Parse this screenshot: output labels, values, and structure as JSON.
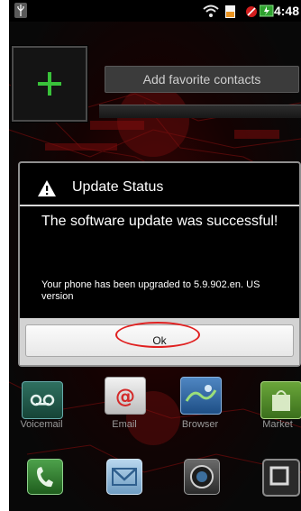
{
  "status_bar": {
    "time": "4:48"
  },
  "home_widget": {
    "favorites_label": "Add favorite contacts"
  },
  "dialog": {
    "title": "Update Status",
    "message": "The software update was successful!",
    "detail": "Your phone has been upgraded to 5.9.902.en. US version",
    "button_label": "Ok"
  },
  "dock": {
    "apps": [
      {
        "label": "Voicemail"
      },
      {
        "label": "Email"
      },
      {
        "label": "Browser"
      },
      {
        "label": "Market"
      }
    ]
  },
  "colors": {
    "accent_red": "#e02020",
    "dialog_divider": "#d8d8d8",
    "plus_green": "#39c23a"
  },
  "icons": [
    "usb-icon",
    "wifi-icon",
    "battery-alert-icon",
    "no-sim-icon",
    "battery-icon",
    "plus-icon",
    "warning-icon",
    "voicemail-icon",
    "email-icon",
    "browser-icon",
    "market-icon",
    "phone-icon",
    "messaging-icon",
    "camera-icon",
    "launcher-icon"
  ]
}
